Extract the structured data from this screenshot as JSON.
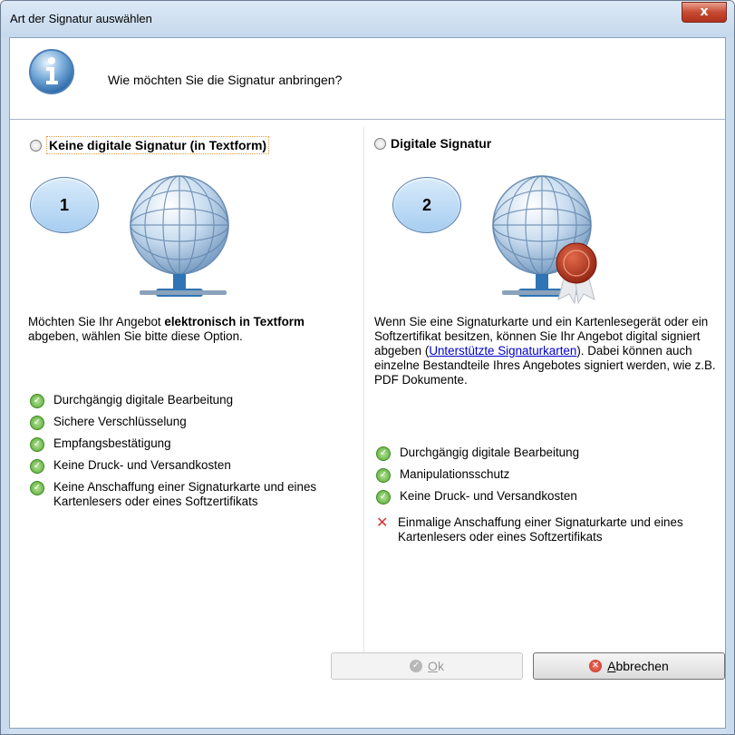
{
  "window": {
    "title": "Art der Signatur auswählen",
    "close_label": "x"
  },
  "header": {
    "question": "Wie möchten Sie die Signatur anbringen?"
  },
  "left": {
    "option_label": "Keine digitale Signatur (in Textform)",
    "badge": "1",
    "desc_part1": "Möchten Sie Ihr Angebot ",
    "desc_bold": "elektronisch in Textform",
    "desc_part2": " abgeben, wählen Sie bitte diese Option.",
    "features": [
      "Durchgängig digitale Bearbeitung",
      "Sichere Verschlüsselung",
      "Empfangsbestätigung",
      "Keine Druck- und Versandkosten",
      "Keine Anschaffung einer Signaturkarte und eines Kartenlesers oder eines Softzertifikats"
    ]
  },
  "right": {
    "option_label": "Digitale Signatur",
    "badge": "2",
    "desc_part1": "Wenn Sie eine Signaturkarte und ein Kartenlesegerät oder ein Softzertifikat besitzen, können Sie Ihr Angebot digital signiert abgeben (",
    "desc_link": "Unterstützte Signaturkarten",
    "desc_part2": "). Dabei können auch einzelne Bestandteile Ihres Angebotes signiert werden, wie z.B. PDF Dokumente.",
    "features": [
      "Durchgängig digitale Bearbeitung",
      "Manipulationsschutz",
      "Keine Druck- und Versandkosten"
    ],
    "negative_feature": "Einmalige Anschaffung einer Signaturkarte und eines Kartenlesers oder eines Softzertifikats"
  },
  "buttons": {
    "ok_first": "O",
    "ok_rest": "k",
    "cancel_first": "A",
    "cancel_rest": "bbrechen"
  },
  "icons": {
    "info": "info-icon",
    "globe": "globe-network-icon",
    "seal": "seal-icon",
    "check": "check-icon",
    "cross": "cross-icon"
  },
  "colors": {
    "link": "#0000cc",
    "check_green": "#4fa52a",
    "cross_red": "#d23434",
    "badge_fill": "#a7cdf0",
    "title_bar": "#c5d8ec"
  }
}
